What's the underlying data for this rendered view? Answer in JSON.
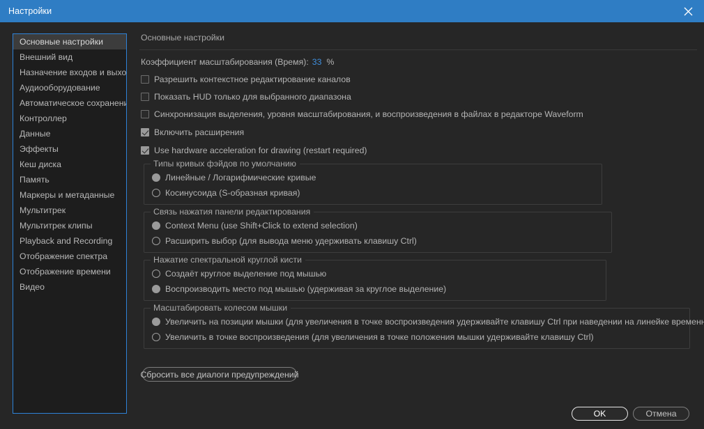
{
  "window": {
    "title": "Настройки",
    "close_icon": "close-icon",
    "title_bar_color": "#2f7dc4",
    "background_color": "#262626",
    "focus_border_color": "#2e82d8"
  },
  "sidebar": {
    "selected_index": 0,
    "items": [
      {
        "label": "Основные настройки"
      },
      {
        "label": "Внешний вид"
      },
      {
        "label": "Назначение входов и выходов"
      },
      {
        "label": "Аудиооборудование"
      },
      {
        "label": "Автоматическое сохранение"
      },
      {
        "label": "Контроллер"
      },
      {
        "label": "Данные"
      },
      {
        "label": "Эффекты"
      },
      {
        "label": "Кеш диска"
      },
      {
        "label": "Память"
      },
      {
        "label": "Маркеры и метаданные"
      },
      {
        "label": "Мультитрек"
      },
      {
        "label": "Мультитрек клипы"
      },
      {
        "label": "Playback and Recording"
      },
      {
        "label": "Отображение спектра"
      },
      {
        "label": "Отображение времени"
      },
      {
        "label": "Видео"
      }
    ]
  },
  "content": {
    "header": "Основные настройки",
    "scale_factor": {
      "label": "Коэффициент масштабирования (Время):",
      "value": "33",
      "unit": "%",
      "value_color": "#3f8fdd"
    },
    "checkboxes": [
      {
        "label": "Разрешить контекстное редактирование каналов",
        "checked": false
      },
      {
        "label": "Показать HUD только для выбранного диапазона",
        "checked": false
      },
      {
        "label": "Синхронизация выделения, уровня масштабирования, и воспроизведения в файлах в редакторе Waveform",
        "checked": false
      },
      {
        "label": "Включить расширения",
        "checked": true
      },
      {
        "label": "Use hardware acceleration for drawing (restart required)",
        "checked": true
      }
    ],
    "groups": [
      {
        "title": "Типы кривых фэйдов по умолчанию",
        "selected_index": 0,
        "options": [
          {
            "label": "Линейные / Логарифмические кривые"
          },
          {
            "label": "Косинусоида (S-образная кривая)"
          }
        ]
      },
      {
        "title": "Связь нажатия панели редактирования",
        "selected_index": 0,
        "options": [
          {
            "label": "Context Menu (use Shift+Click to extend selection)"
          },
          {
            "label": "Расширить выбор (для вывода меню удерживать клавишу Ctrl)"
          }
        ]
      },
      {
        "title": "Нажатие спектральной круглой кисти",
        "selected_index": 1,
        "options": [
          {
            "label": "Создаёт круглое выделение под мышью"
          },
          {
            "label": "Воспроизводить место под мышью (удерживая за круглое выделение)"
          }
        ]
      },
      {
        "title": "Масштабировать колесом мышки",
        "selected_index": 0,
        "options": [
          {
            "label": "Увеличить на позиции мышки (для увеличения в точке воспроизведения удерживайте клавишу Ctrl при наведении на линейке временной шкалы)"
          },
          {
            "label": "Увеличить в точке воспроизведения (для увеличения в точке положения мышки удерживайте клавишу Ctrl)"
          }
        ]
      }
    ],
    "reset_button": "Сбросить все диалоги предупреждений"
  },
  "footer": {
    "ok_button": "OK",
    "cancel_button": "Отмена"
  }
}
